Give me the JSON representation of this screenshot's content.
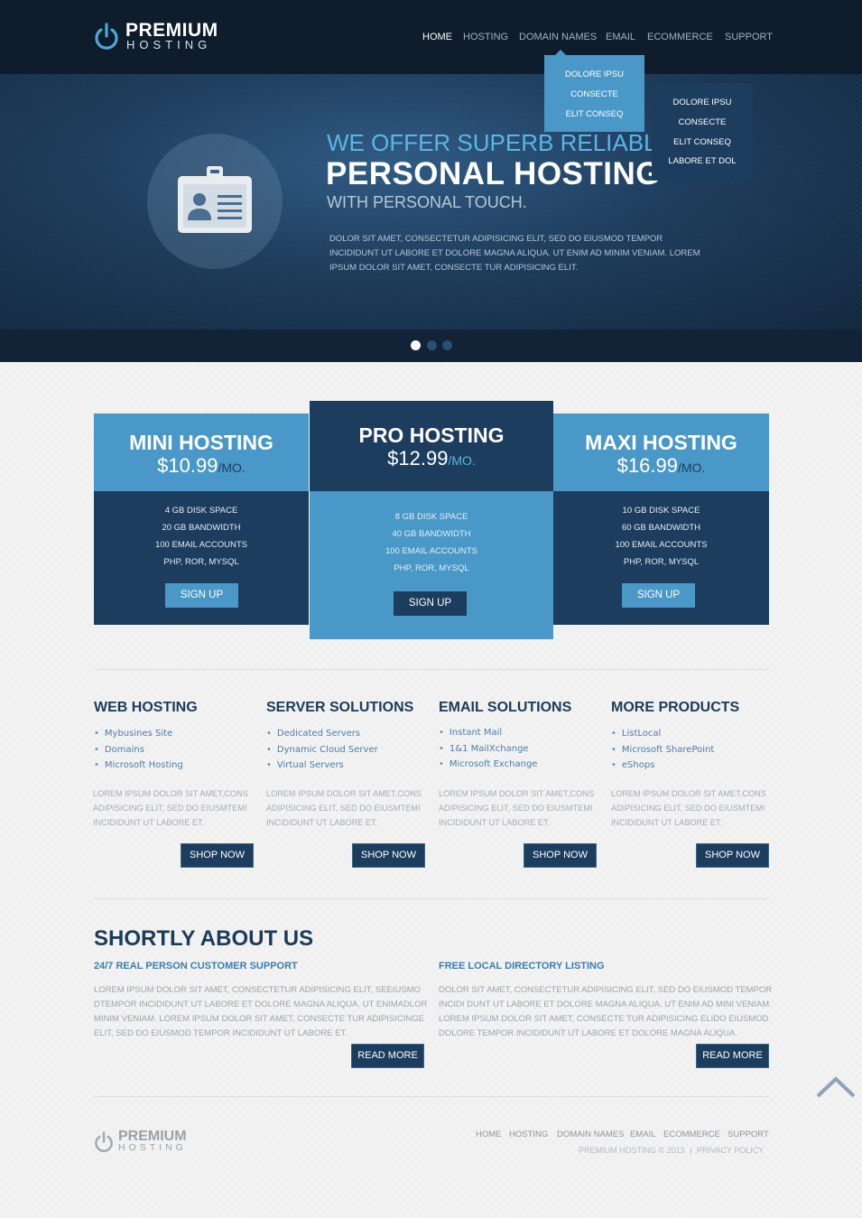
{
  "brand": {
    "name": "PREMIUM",
    "tagline": "HOSTING"
  },
  "nav": [
    {
      "label": "HOME",
      "active": true
    },
    {
      "label": "HOSTING",
      "active": false
    },
    {
      "label": "DOMAIN NAMES",
      "active": false
    },
    {
      "label": "EMAIL",
      "active": false
    },
    {
      "label": "ECOMMERCE",
      "active": false
    },
    {
      "label": "SUPPORT",
      "active": false
    }
  ],
  "dropdown_level1": [
    "DOLORE IPSU",
    "CONSECTE",
    "ELIT CONSEQ"
  ],
  "dropdown_level2": [
    "DOLORE IPSU",
    "CONSECTE",
    "ELIT CONSEQ",
    "LABORE ET DOL"
  ],
  "hero": {
    "line1": "WE OFFER SUPERB RELIABLE",
    "line2": "PERSONAL HOSTING",
    "line3": "WITH PERSONAL TOUCH.",
    "text": "DOLOR SIT AMET, CONSECTETUR ADIPISICING ELIT, SED DO EIUSMOD TEMPOR INCIDIDUNT UT LABORE ET DOLORE MAGNA ALIQUA. UT ENIM AD MINIM VENIAM. LOREM IPSUM DOLOR SIT AMET, CONSECTE TUR ADIPISICING ELIT.",
    "icon": "id-badge-icon",
    "slides_total": 3,
    "slide_active": 1
  },
  "plans": [
    {
      "name": "MINI HOSTING",
      "price": "$10.99",
      "per": "/MO.",
      "features": [
        "4 GB DISK SPACE",
        "20 GB BANDWIDTH",
        "100 EMAIL ACCOUNTS",
        "PHP, ROR, MYSQL"
      ],
      "button": "SIGN UP"
    },
    {
      "name": "PRO HOSTING",
      "price": "$12.99",
      "per": "/MO.",
      "features": [
        "8 GB DISK SPACE",
        "40 GB BANDWIDTH",
        "100 EMAIL ACCOUNTS",
        "PHP, ROR, MYSQL"
      ],
      "button": "SIGN UP"
    },
    {
      "name": "MAXI HOSTING",
      "price": "$16.99",
      "per": "/MO.",
      "features": [
        "10 GB DISK SPACE",
        "60 GB BANDWIDTH",
        "100 EMAIL ACCOUNTS",
        "PHP, ROR, MYSQL"
      ],
      "button": "SIGN UP"
    }
  ],
  "products": [
    {
      "title": "WEB HOSTING",
      "links": [
        "Mybusines Site",
        "Domains",
        "Microsoft Hosting"
      ],
      "text": "LOREM IPSUM DOLOR SIT AMET,CONS ADIPISICING ELIT, SED DO EIUSMTEMI INCIDIDUNT UT LABORE ET.",
      "button": "SHOP NOW"
    },
    {
      "title": "SERVER SOLUTIONS",
      "links": [
        "Dedicated Servers",
        "Dynamic Cloud Server",
        "Virtual Servers"
      ],
      "text": "LOREM IPSUM DOLOR SIT AMET,CONS ADIPISICING ELIT, SED DO EIUSMTEMI INCIDIDUNT UT LABORE ET.",
      "button": "SHOP NOW"
    },
    {
      "title": "EMAIL SOLUTIONS",
      "links": [
        "Instant Mail",
        "1&1 MailXchange",
        "Microsoft Exchange"
      ],
      "text": "LOREM IPSUM DOLOR SIT AMET,CONS ADIPISICING ELIT, SED DO EIUSMTEMI INCIDIDUNT UT LABORE ET.",
      "button": "SHOP NOW"
    },
    {
      "title": "MORE PRODUCTS",
      "links": [
        "ListLocal",
        "Microsoft SharePoint",
        "eShops"
      ],
      "text": "LOREM IPSUM DOLOR SIT AMET,CONS ADIPISICING ELIT, SED DO EIUSMTEMI INCIDIDUNT UT LABORE ET.",
      "button": "SHOP NOW"
    }
  ],
  "about": {
    "title": "SHORTLY ABOUT US",
    "columns": [
      {
        "subtitle": "24/7 REAL PERSON CUSTOMER SUPPORT",
        "text": "LOREM IPSUM DOLOR SIT AMET, CONSECTETUR ADIPISICING ELIT, SEEIUSMO DTEMPOR INCIDIDUNT UT LABORE ET DOLORE MAGNA ALIQUA. UT ENIMADLOR MINIM VENIAM. LOREM IPSUM DOLOR SIT AMET, CONSECTE TUR ADIPISICINGE ELIT, SED DO EIUSMOD TEMPOR INCIDIDUNT UT LABORE ET.",
        "button": "READ MORE"
      },
      {
        "subtitle": "FREE LOCAL DIRECTORY LISTING",
        "text": "DOLOR SIT AMET, CONSECTETUR ADIPISICING ELIT, SED DO EIUSMOD TEMPOR INCIDI DUNT UT LABORE ET DOLORE MAGNA ALIQUA. UT ENIM AD MINI VENIAM. LOREM IPSUM DOLOR SIT AMET, CONSECTE TUR ADIPISICING ELIDO EIUSMOD DOLORE TEMPOR INCIDIDUNT UT LABORE ET DOLORE MAGNA ALIQUA.",
        "button": "READ MORE"
      }
    ]
  },
  "footer": {
    "brand": "PREMIUM",
    "tagline": "HOSTING",
    "nav": [
      "HOME",
      "HOSTING",
      "DOMAIN NAMES",
      "EMAIL",
      "ECOMMERCE",
      "SUPPORT"
    ],
    "copyright": "PREMIUM HOSTING © 2013",
    "separator": "|",
    "privacy": "PRIVACY POLICY"
  },
  "colors": {
    "header_bg": "#0f1c2b",
    "accent_light": "#4a98c7",
    "accent_dark": "#1c3d5e",
    "hero_highlight": "#58b7e8"
  },
  "icons": [
    "power-icon",
    "id-badge-icon",
    "chevron-up-icon",
    "bullet-icon"
  ]
}
